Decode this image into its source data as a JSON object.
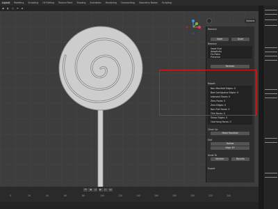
{
  "topbar": {
    "tabs": [
      "Layout",
      "Modeling",
      "Sculpting",
      "UV Editing",
      "Texture Paint",
      "Shading",
      "Animation",
      "Rendering",
      "Compositing",
      "Geometry Nodes",
      "Scripting"
    ],
    "active_tab": "Layout"
  },
  "viewport_header": {
    "options_label": "Options"
  },
  "panel": {
    "remesh_title": "Remesh",
    "mode_buttons": [
      "Voxel",
      "Quad"
    ],
    "section_title": "Remesh",
    "voxel_rows": [
      "Voxel Size",
      "Adaptivity",
      "Fix Poles",
      "Preserve"
    ],
    "report_title": "Report",
    "report_rows": [
      "Non-Manifold Edges: 0",
      "Bad Contiguous Edges: 0",
      "Intersect Faces: 0",
      "Zero Faces: 0",
      "Zero Edges: 0",
      "Non-Flat Faces: 0",
      "Thin Faces: 0",
      "Sharp Edges: 0",
      "Overhang Faces: 0"
    ],
    "clean_up_title": "Clean Up",
    "make_manifold_label": "Make Manifold",
    "edit_title": "Edit",
    "edit_buttons": [
      "Hollow",
      "Align XY"
    ],
    "scale_to_title": "Scale To",
    "scale_buttons": [
      "Volume",
      "Bounds"
    ],
    "export_title": "Export"
  },
  "timeline": {
    "ruler_ticks": [
      "0",
      "20",
      "40",
      "60",
      "80",
      "100",
      "120",
      "140",
      "160",
      "180",
      "200",
      "220",
      "240"
    ]
  },
  "colors": {
    "highlight": "#d81a1a",
    "viewport_bg": "#3d3d3d",
    "panel_bg": "#2e2e2e",
    "axis_x": "#e0435a",
    "axis_y": "#7cb342",
    "axis_z": "#3f8fe0"
  }
}
